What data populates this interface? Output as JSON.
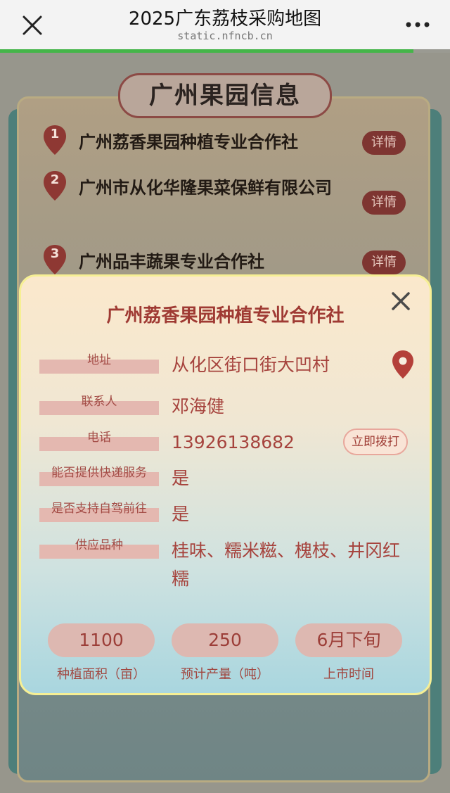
{
  "browser": {
    "title": "2025广东荔枝采购地图",
    "url": "static.nfncb.cn",
    "close_icon": "close-icon",
    "more_icon": "more-icon"
  },
  "panel": {
    "header": "广州果园信息",
    "items": [
      {
        "number": "1",
        "name": "广州荔香果园种植专业合作社",
        "detail": "详情"
      },
      {
        "number": "2",
        "name": "广州市从化华隆果菜保鲜有限公司",
        "detail": "详情"
      },
      {
        "number": "3",
        "name": "广州品丰蔬果专业合作社",
        "detail": "详情"
      }
    ]
  },
  "modal": {
    "title": "广州荔香果园种植专业合作社",
    "rows": [
      {
        "label": "地址",
        "value": "从化区街口街大凹村"
      },
      {
        "label": "联系人",
        "value": "邓海健"
      },
      {
        "label": "电话",
        "value": "13926138682"
      },
      {
        "label": "能否提供快递服务",
        "value": "是"
      },
      {
        "label": "是否支持自驾前往",
        "value": "是"
      },
      {
        "label": "供应品种",
        "value": "桂味、糯米糍、槐枝、井冈红糯"
      }
    ],
    "call_button": "立即拨打",
    "stats": [
      {
        "value": "1100",
        "label": "种植面积（亩）"
      },
      {
        "value": "250",
        "label": "预计产量（吨）"
      },
      {
        "value": "6月下旬",
        "label": "上市时间"
      }
    ]
  },
  "colors": {
    "accent": "#9f3a33",
    "detail_button": "#7e3531",
    "progress": "#45b549"
  }
}
